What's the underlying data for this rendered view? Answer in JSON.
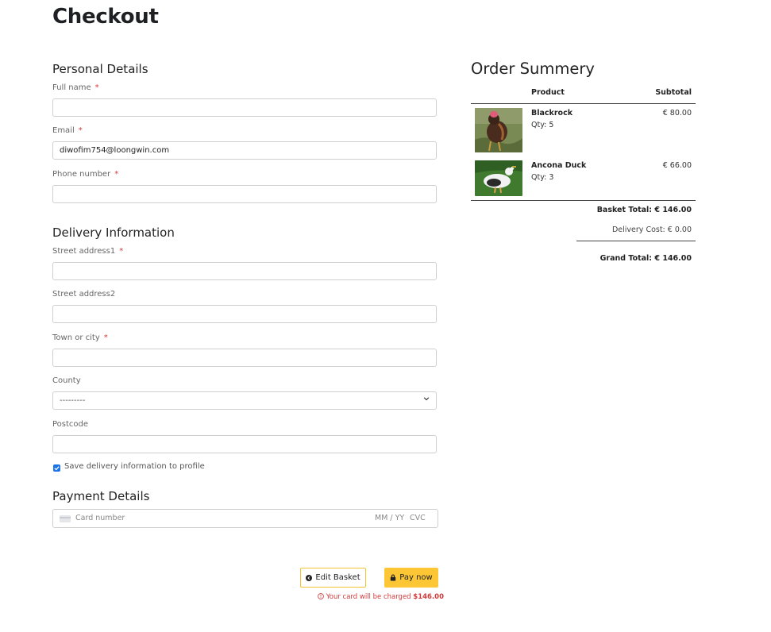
{
  "page": {
    "title": "Checkout"
  },
  "personal": {
    "title": "Personal Details",
    "full_name_label": "Full name",
    "full_name_value": "",
    "email_label": "Email",
    "email_value": "diwofim754@loongwin.com",
    "phone_label": "Phone number",
    "phone_value": "",
    "required_mark": "*"
  },
  "delivery": {
    "title": "Delivery Information",
    "street1_label": "Street address1",
    "street2_label": "Street address2",
    "town_label": "Town or city",
    "county_label": "County",
    "county_selected": "---------",
    "postcode_label": "Postcode",
    "save_label": "Save delivery information to profile",
    "save_checked": true
  },
  "payment": {
    "title": "Payment Details",
    "card_placeholder": "Card number",
    "exp_placeholder": "MM / YY",
    "cvc_placeholder": "CVC"
  },
  "actions": {
    "edit_label": "Edit Basket",
    "pay_label": "Pay now",
    "charge_text": "Your card will be charged",
    "charge_amount": "$146.00"
  },
  "summary": {
    "title": "Order Summery",
    "col_product": "Product",
    "col_subtotal": "Subtotal",
    "items": [
      {
        "name": "Blackrock",
        "qty": "Qty: 5",
        "price": "€ 80.00"
      },
      {
        "name": "Ancona Duck",
        "qty": "Qty: 3",
        "price": "€ 66.00"
      }
    ],
    "basket_total": "Basket Total: € 146.00",
    "delivery_cost": "Delivery Cost: € 0.00",
    "grand_total": "Grand Total: € 146.00"
  },
  "colors": {
    "accent": "#fcc634",
    "error": "#d43a3a",
    "checkbox": "#1a73e8"
  }
}
